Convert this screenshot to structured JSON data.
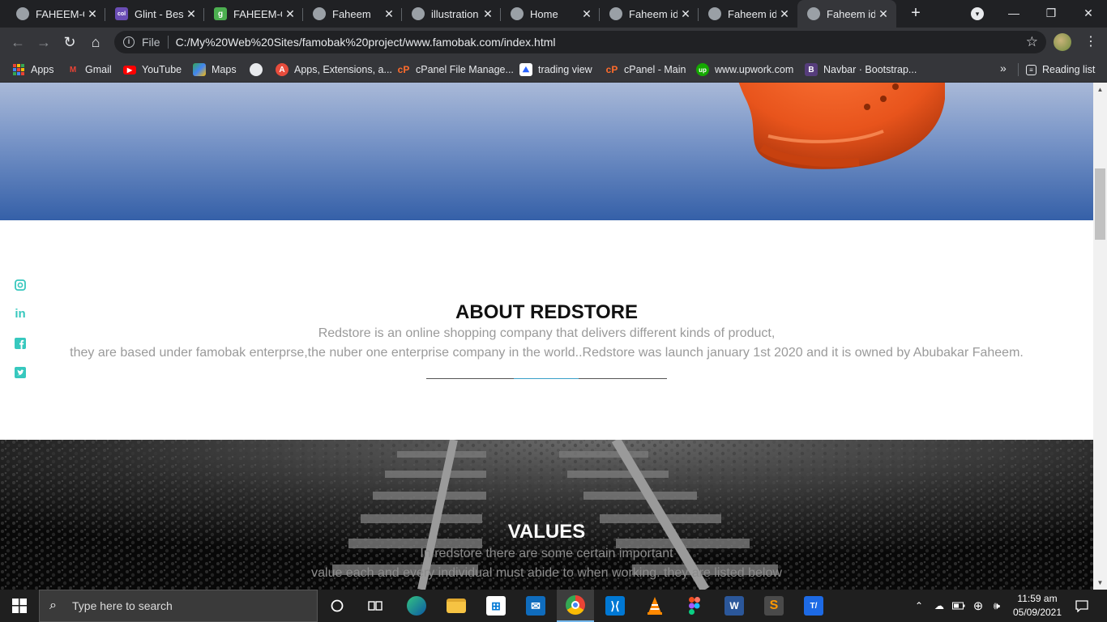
{
  "browser": {
    "tabs": [
      {
        "title": "FAHEEM-G",
        "favicon": "globe-icon"
      },
      {
        "title": "Glint - Best",
        "favicon": "colorlib-icon"
      },
      {
        "title": "FAHEEM-G",
        "favicon": "g-icon"
      },
      {
        "title": "Faheem",
        "favicon": "globe-icon"
      },
      {
        "title": "illustration",
        "favicon": "globe-icon"
      },
      {
        "title": "Home",
        "favicon": "globe-icon"
      },
      {
        "title": "Faheem ide",
        "favicon": "globe-icon"
      },
      {
        "title": "Faheem ide",
        "favicon": "globe-icon"
      },
      {
        "title": "Faheem ide",
        "favicon": "globe-icon",
        "active": true
      }
    ],
    "tab_close_glyph": "✕",
    "new_tab_glyph": "+",
    "window_controls": {
      "minimize": "—",
      "restore": "❐",
      "close": "✕"
    },
    "address": {
      "scheme_label": "File",
      "url": "C:/My%20Web%20Sites/famobak%20project/www.famobak.com/index.html"
    },
    "bookmarks": [
      {
        "label": "Apps",
        "icon": "apps-grid-icon"
      },
      {
        "label": "Gmail",
        "icon": "gmail-icon"
      },
      {
        "label": "YouTube",
        "icon": "youtube-icon"
      },
      {
        "label": "Maps",
        "icon": "maps-icon"
      },
      {
        "label": "",
        "icon": "globe-icon"
      },
      {
        "label": "Apps, Extensions, a...",
        "icon": "extensions-icon"
      },
      {
        "label": "cPanel File Manage...",
        "icon": "cpanel-icon"
      },
      {
        "label": "trading view",
        "icon": "tradingview-icon"
      },
      {
        "label": "cPanel - Main",
        "icon": "cpanel-icon"
      },
      {
        "label": "www.upwork.com",
        "icon": "upwork-icon"
      },
      {
        "label": "Navbar · Bootstrap...",
        "icon": "bootstrap-icon"
      }
    ],
    "bookmarks_overflow": "»",
    "reading_list": "Reading list"
  },
  "page": {
    "about": {
      "heading": "ABOUT REDSTORE",
      "line1": "Redstore is an online shopping company that delivers different kinds of product,",
      "line2": "they are based under famobak enterprse,the nuber one enterprise company in the world..Redstore was launch january 1st 2020 and it is owned by Abubakar Faheem."
    },
    "values": {
      "heading": "VALUES",
      "line1": "In redstore there are some certain important",
      "line2": "value each and every individual must abide to when working. they are listed below"
    },
    "social_icons": [
      "instagram-icon",
      "linkedin-icon",
      "facebook-icon",
      "twitter-icon"
    ]
  },
  "taskbar": {
    "search_placeholder": "Type here to search",
    "pinned": [
      "cortana-icon",
      "task-view-icon",
      "edge-icon",
      "file-explorer-icon",
      "store-icon",
      "mail-icon",
      "chrome-icon",
      "vscode-icon",
      "vlc-icon",
      "figma-icon",
      "word-icon",
      "sublime-icon",
      "typora-icon"
    ],
    "clock_time": "11:59 am",
    "clock_date": "05/09/2021"
  },
  "colors": {
    "accent_social": "#37c8be",
    "hero_blue": "#3560a8",
    "shoe_orange": "#e8541c"
  }
}
